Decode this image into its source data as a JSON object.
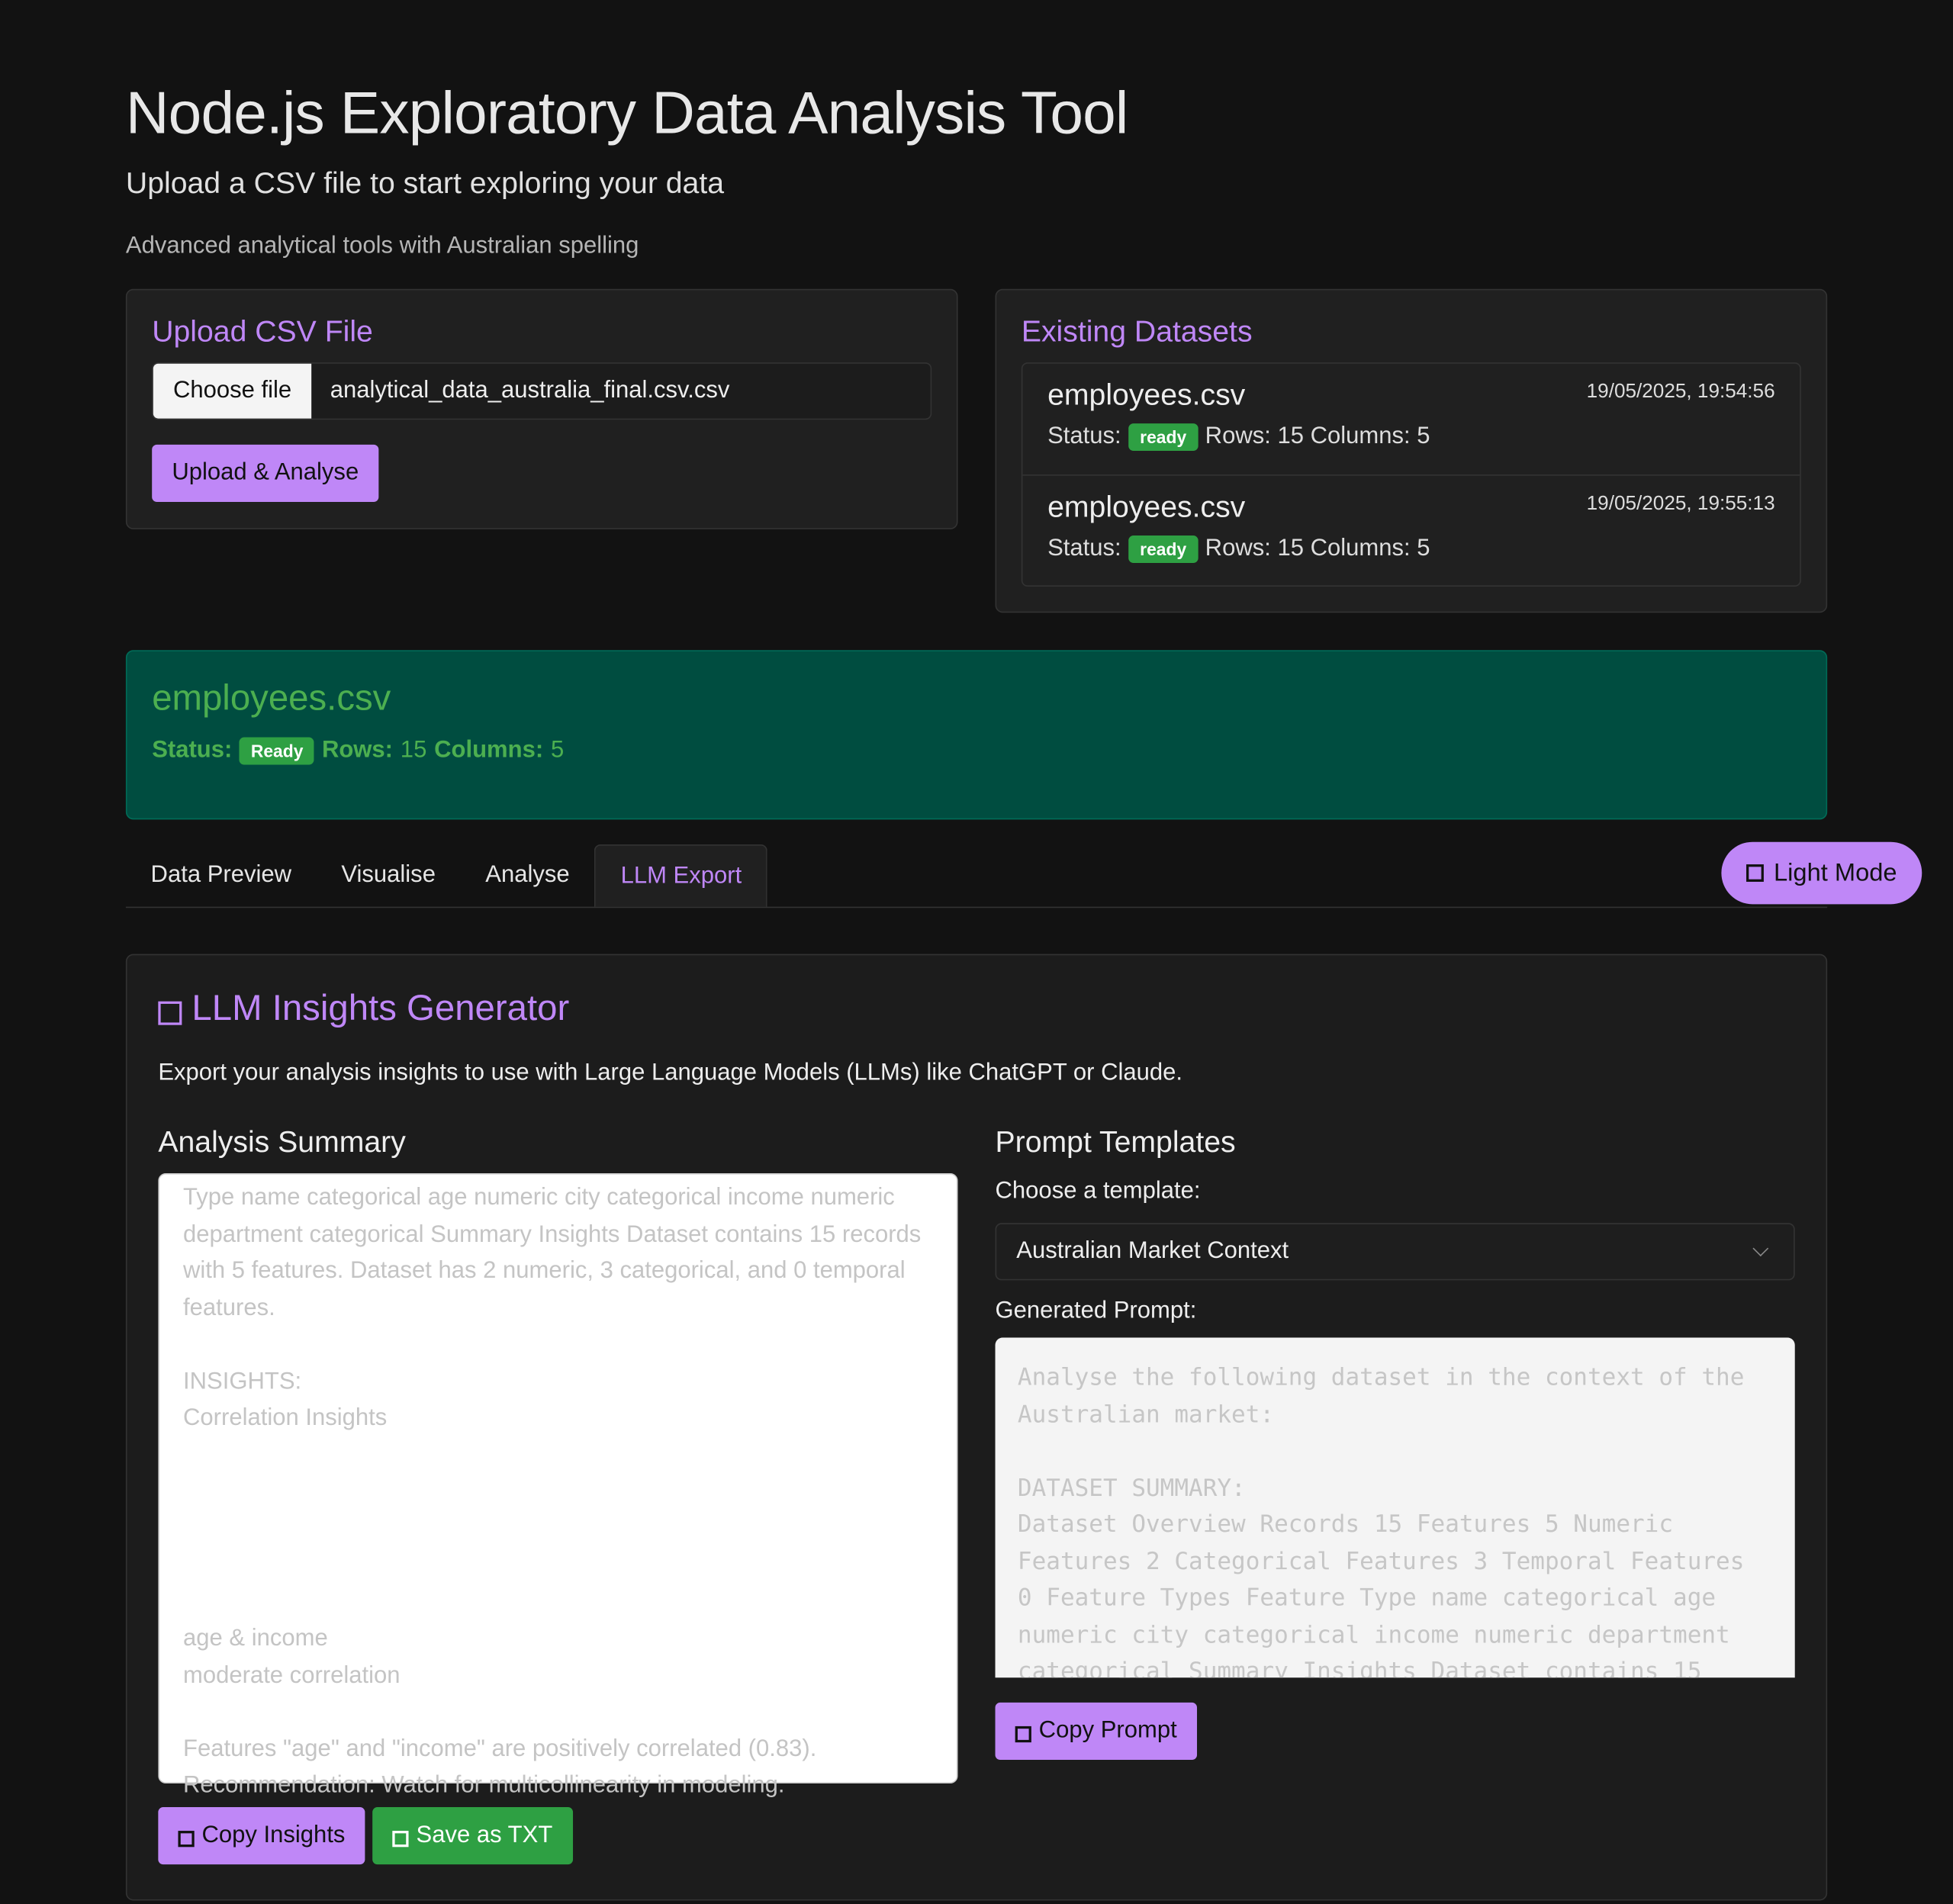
{
  "header": {
    "title": "Node.js Exploratory Data Analysis Tool",
    "subtitle": "Upload a CSV file to start exploring your data",
    "tagline": "Advanced analytical tools with Australian spelling"
  },
  "upload": {
    "title": "Upload CSV File",
    "choose_label": "Choose file",
    "file_name": "analytical_data_australia_final.csv.csv",
    "submit_label": "Upload & Analyse"
  },
  "existing": {
    "title": "Existing Datasets",
    "items": [
      {
        "name": "employees.csv",
        "date": "19/05/2025, 19:54:56",
        "status_label": "Status:",
        "status": "ready",
        "stats": "Rows: 15 Columns: 5"
      },
      {
        "name": "employees.csv",
        "date": "19/05/2025, 19:55:13",
        "status_label": "Status:",
        "status": "ready",
        "stats": "Rows: 15 Columns: 5"
      }
    ]
  },
  "selected": {
    "name": "employees.csv",
    "status_label": "Status:",
    "status": "Ready",
    "rows_label": "Rows:",
    "rows": "15",
    "columns_label": "Columns:",
    "columns": "5"
  },
  "tabs": [
    {
      "label": "Data Preview",
      "active": false
    },
    {
      "label": "Visualise",
      "active": false
    },
    {
      "label": "Analyse",
      "active": false
    },
    {
      "label": "LLM Export",
      "active": true
    }
  ],
  "theme_toggle": {
    "label": "Light Mode"
  },
  "llm": {
    "title": "LLM Insights Generator",
    "description": "Export your analysis insights to use with Large Language Models (LLMs) like ChatGPT or Claude.",
    "summary_title": "Analysis Summary",
    "summary_text": "Type name categorical age numeric city categorical income numeric department categorical Summary Insights Dataset contains 15 records with 5 features. Dataset has 2 numeric, 3 categorical, and 0 temporal features.\n\nINSIGHTS:\nCorrelation Insights\n\n\n\n\n\nage & income\nmoderate correlation\n\nFeatures \"age\" and \"income\" are positively correlated (0.83). Recommendation: Watch for multicollinearity in modeling.",
    "copy_insights_label": "Copy Insights",
    "save_txt_label": "Save as TXT",
    "templates_title": "Prompt Templates",
    "choose_template_label": "Choose a template:",
    "selected_template": "Australian Market Context",
    "generated_label": "Generated Prompt:",
    "prompt_text": "Analyse the following dataset in the context of the Australian market:\n\nDATASET SUMMARY:\nDataset Overview Records 15 Features 5 Numeric Features 2 Categorical Features 3 Temporal Features 0 Feature Types Feature Type name categorical age numeric city categorical income numeric department categorical Summary Insights Dataset contains 15",
    "copy_prompt_label": "Copy Prompt"
  },
  "colors": {
    "accent": "#bf87f7",
    "success": "#2ea043",
    "selected_bg": "#004d40",
    "selected_text": "#4caf50",
    "background": "#121212"
  },
  "icons": [
    "checkbox-square-icon",
    "chevron-down-icon"
  ]
}
